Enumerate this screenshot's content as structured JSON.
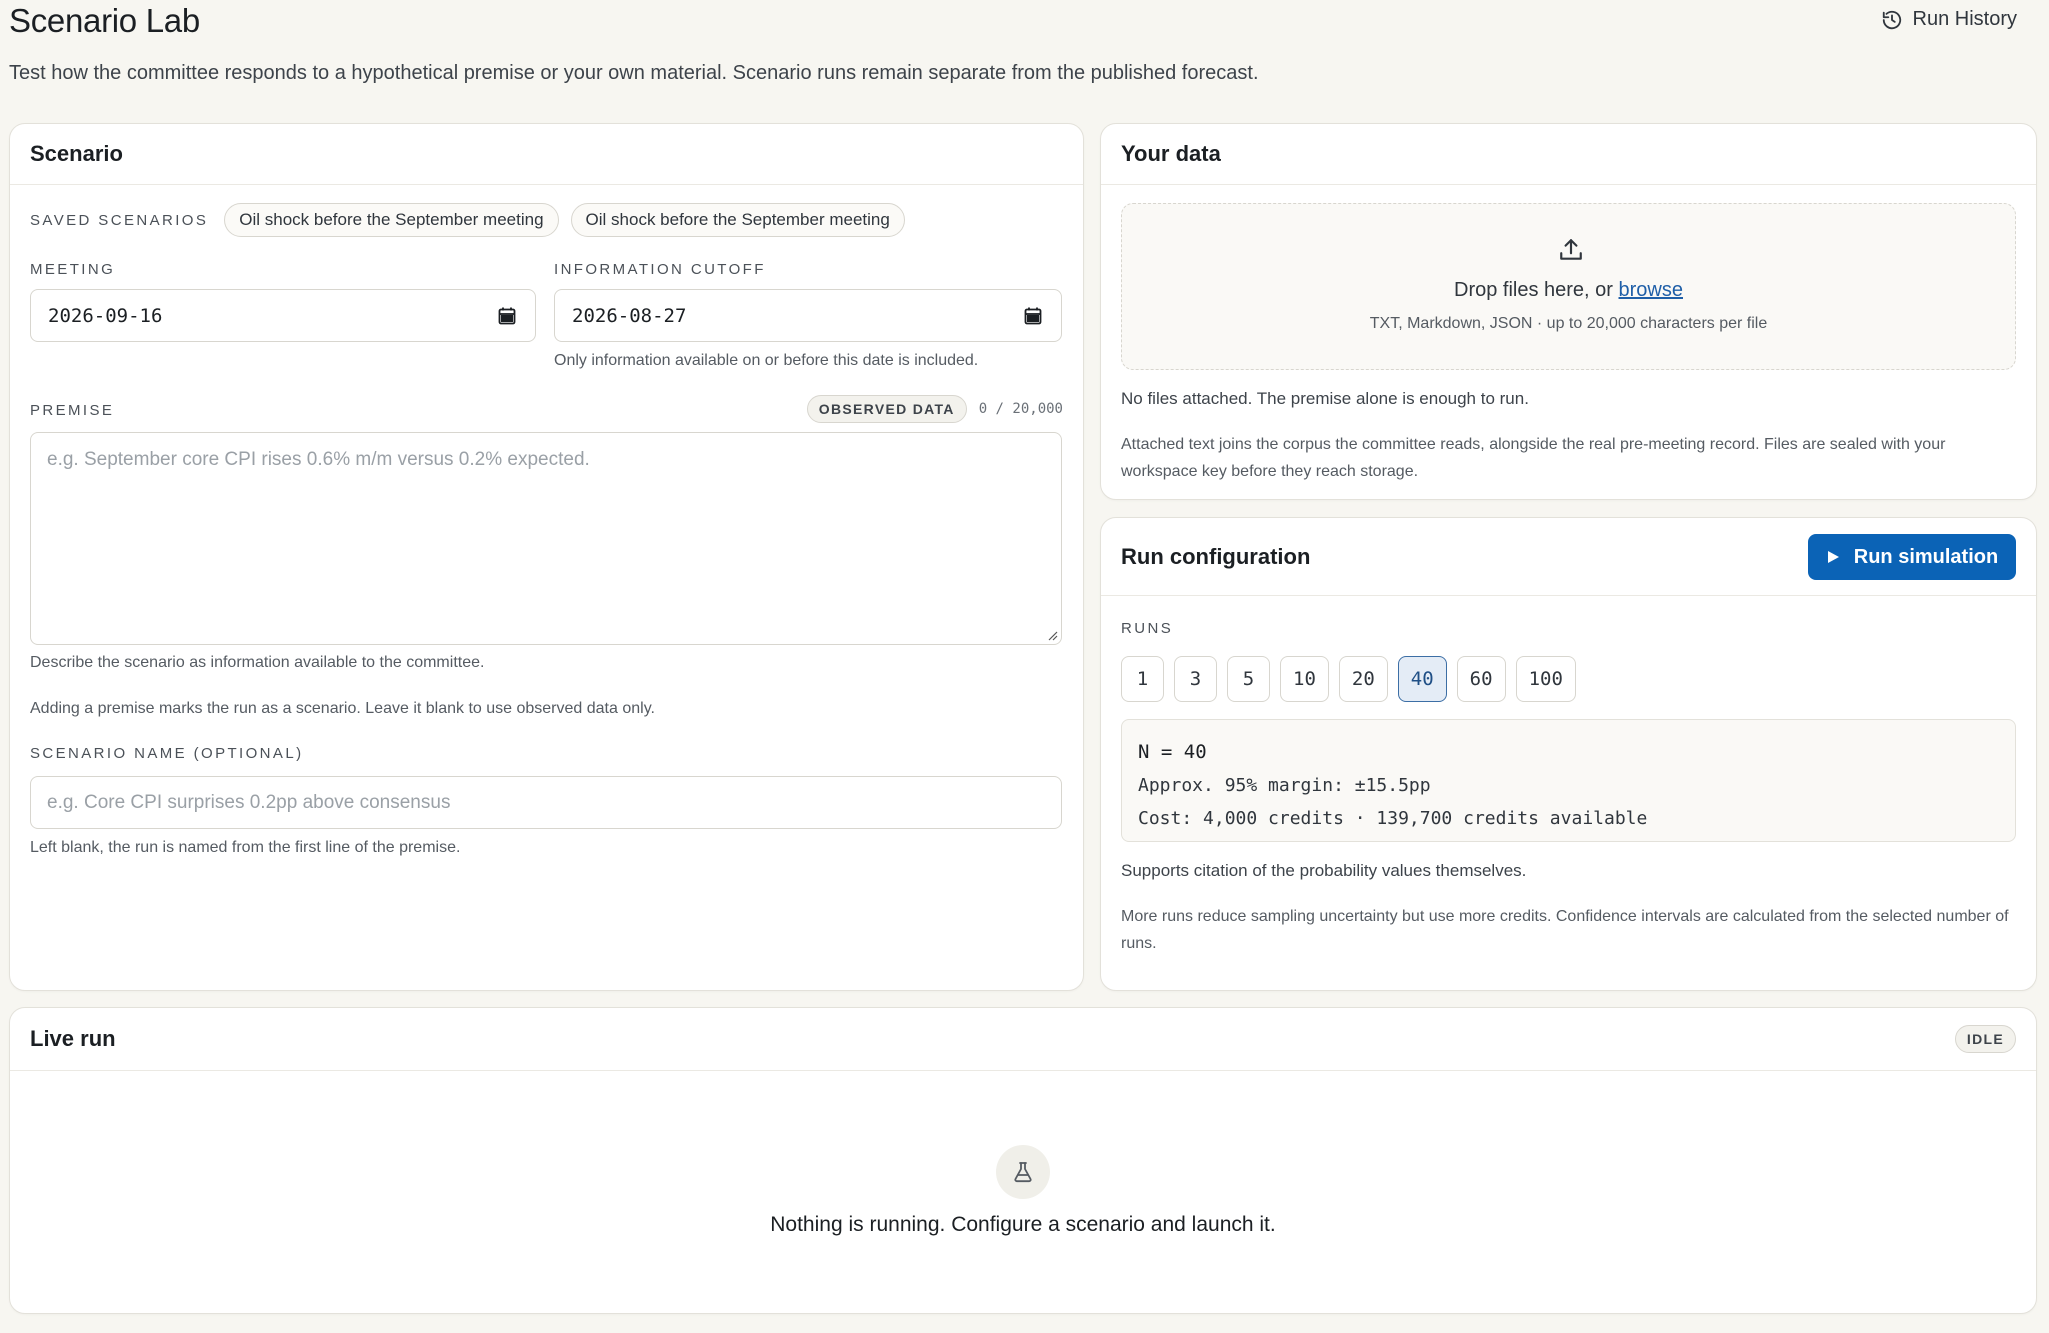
{
  "header": {
    "title": "Scenario Lab",
    "subtitle": "Test how the committee responds to a hypothetical premise or your own material. Scenario runs remain separate from the published forecast.",
    "history_label": "Run History"
  },
  "scenario": {
    "title": "Scenario",
    "saved_label": "Saved scenarios",
    "saved": [
      "Oil shock before the September meeting",
      "Oil shock before the September meeting"
    ],
    "meeting_label": "Meeting",
    "meeting_value": "2026-09-16",
    "cutoff_label": "Information cutoff",
    "cutoff_value": "2026-08-27",
    "cutoff_help": "Only information available on or before this date is included.",
    "premise_label": "Premise",
    "premise_badge": "Observed data",
    "premise_count": "0 / 20,000",
    "premise_placeholder": "e.g. September core CPI rises 0.6% m/m versus 0.2% expected.",
    "premise_help": "Describe the scenario as information available to the committee.",
    "premise_note": "Adding a premise marks the run as a scenario. Leave it blank to use observed data only.",
    "name_label": "Scenario name (optional)",
    "name_placeholder": "e.g. Core CPI surprises 0.2pp above consensus",
    "name_help": "Left blank, the run is named from the first line of the premise."
  },
  "data": {
    "title": "Your data",
    "drop_text": "Drop files here, or ",
    "browse": "browse",
    "drop_sub": "TXT, Markdown, JSON · up to 20,000 characters per file",
    "no_files": "No files attached. The premise alone is enough to run.",
    "note": "Attached text joins the corpus the committee reads, alongside the real pre-meeting record. Files are sealed with your workspace key before they reach storage."
  },
  "run": {
    "title": "Run configuration",
    "button": "Run simulation",
    "runs_label": "Runs",
    "options": [
      "1",
      "3",
      "5",
      "10",
      "20",
      "40",
      "60",
      "100"
    ],
    "selected": "40",
    "n_line": "N = 40",
    "margin_line": "Approx. 95% margin: ±15.5pp",
    "cost_line": "Cost: 4,000 credits · 139,700 credits available",
    "support": "Supports citation of the probability values themselves.",
    "note": "More runs reduce sampling uncertainty but use more credits. Confidence intervals are calculated from the selected number of runs."
  },
  "live": {
    "title": "Live run",
    "status": "IDLE",
    "empty": "Nothing is running. Configure a scenario and launch it."
  },
  "colors": {
    "accent": "#0b63b6",
    "background": "#f7f6f1",
    "selected_run": "#e4ecf6"
  }
}
